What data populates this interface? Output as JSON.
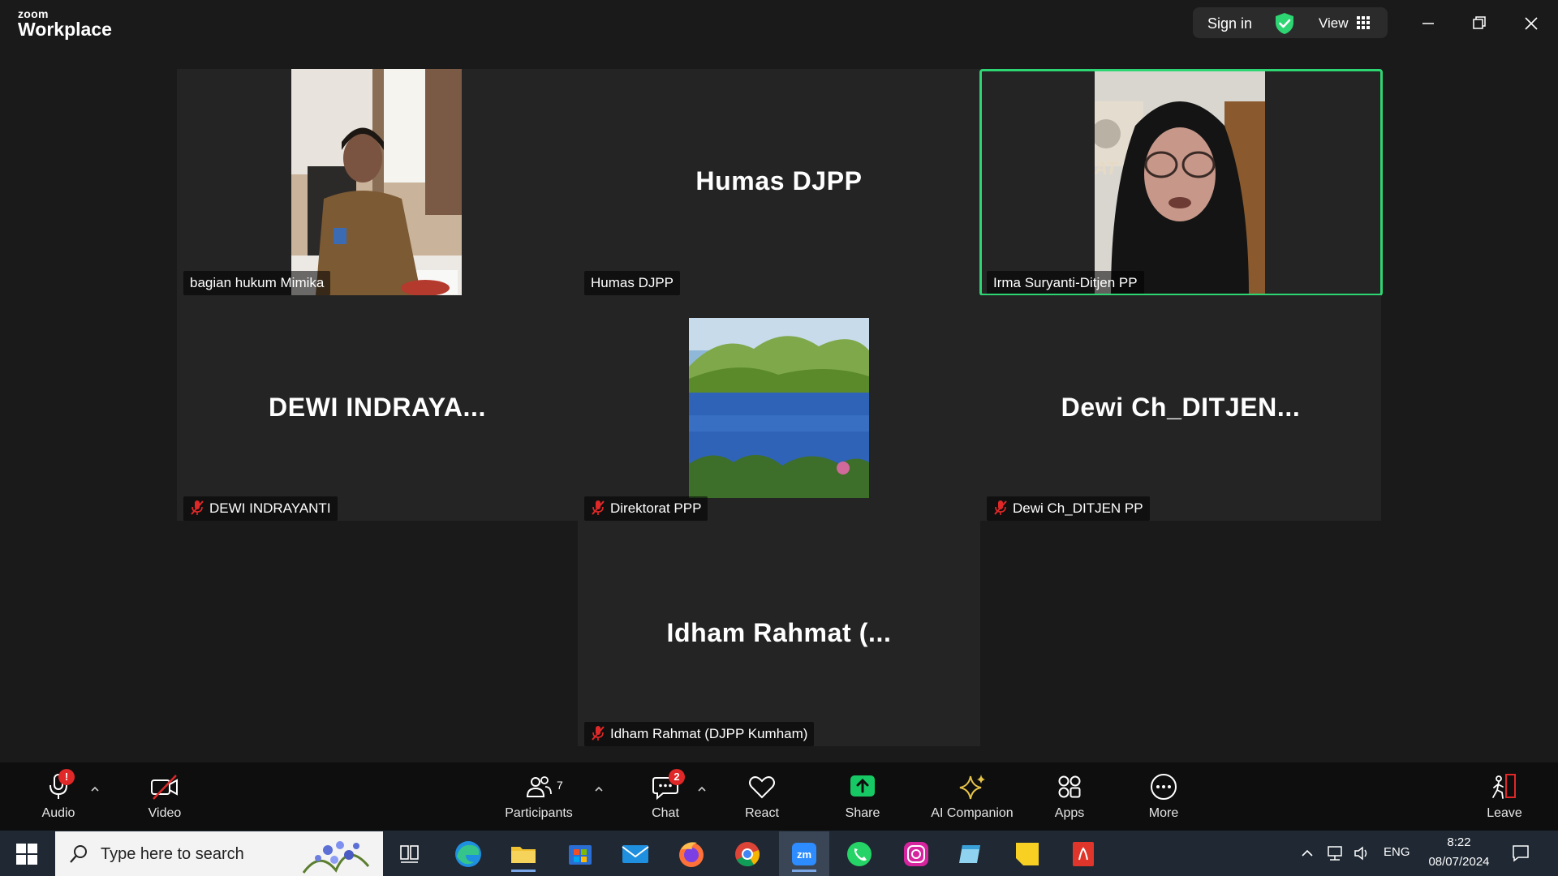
{
  "app": {
    "logo_small": "zoom",
    "logo_big": "Workplace"
  },
  "topbar": {
    "signin": "Sign in",
    "view": "View"
  },
  "tiles": [
    {
      "name": "bagian hukum Mimika",
      "big": ""
    },
    {
      "name": "Humas DJPP",
      "big": "Humas DJPP"
    },
    {
      "name": "Irma Suryanti-Ditjen PP",
      "big": ""
    },
    {
      "name": "DEWI INDRAYANTI",
      "big": "DEWI  INDRAYA..."
    },
    {
      "name": "Direktorat PPP",
      "big": ""
    },
    {
      "name": "Dewi Ch_DITJEN PP",
      "big": "Dewi  Ch_DITJEN..."
    },
    {
      "name": "Idham Rahmat (DJPP Kumham)",
      "big": "Idham  Rahmat  (..."
    }
  ],
  "toolbar": {
    "audio": "Audio",
    "audio_badge": "!",
    "video": "Video",
    "participants": "Participants",
    "participants_count": "7",
    "chat": "Chat",
    "chat_badge": "2",
    "react": "React",
    "share": "Share",
    "ai_companion": "AI Companion",
    "apps": "Apps",
    "more": "More",
    "leave": "Leave"
  },
  "taskbar": {
    "search_placeholder": "Type here to search",
    "lang": "ENG",
    "time": "8:22",
    "date": "08/07/2024"
  },
  "colors": {
    "active_speaker": "#2ed573",
    "share": "#17c964",
    "muted": "#e02828"
  }
}
